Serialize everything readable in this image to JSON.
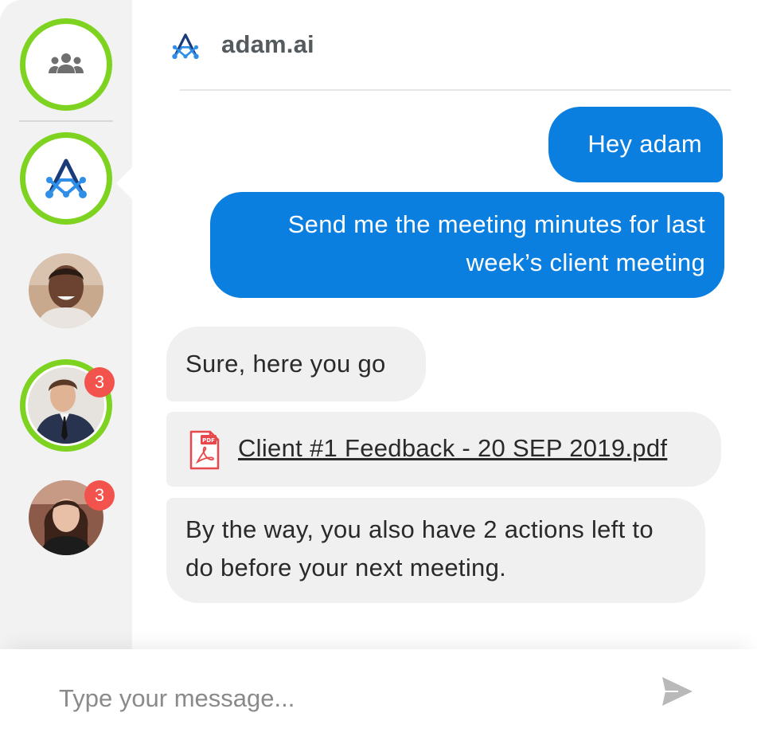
{
  "header": {
    "title": "adam.ai"
  },
  "sidebar": {
    "items": [
      {
        "name": "group",
        "icon": "group-icon"
      },
      {
        "name": "adam",
        "icon": "adam-logo-icon"
      },
      {
        "name": "user-1",
        "badge": ""
      },
      {
        "name": "user-2",
        "badge": "3"
      },
      {
        "name": "user-3",
        "badge": "3"
      }
    ]
  },
  "messages": [
    {
      "direction": "outgoing",
      "text": "Hey adam"
    },
    {
      "direction": "outgoing",
      "lines": [
        "Send me the meeting minutes for last",
        "week’s client meeting"
      ]
    },
    {
      "direction": "incoming",
      "text": "Sure, here you go"
    },
    {
      "direction": "incoming",
      "type": "file",
      "icon": "pdf-file-icon",
      "filename": "Client #1 Feedback - 20 SEP 2019.pdf"
    },
    {
      "direction": "incoming",
      "lines": [
        "By the way, you also have 2 actions left to",
        "do before your next meeting."
      ]
    }
  ],
  "composer": {
    "placeholder": "Type your message...",
    "send_icon": "send-icon"
  },
  "colors": {
    "accent_blue": "#0a7fe0",
    "ring_green": "#7ed321",
    "badge_red": "#f2544d",
    "incoming_bg": "#f0f0f0",
    "sidebar_bg": "#f2f2f2"
  }
}
